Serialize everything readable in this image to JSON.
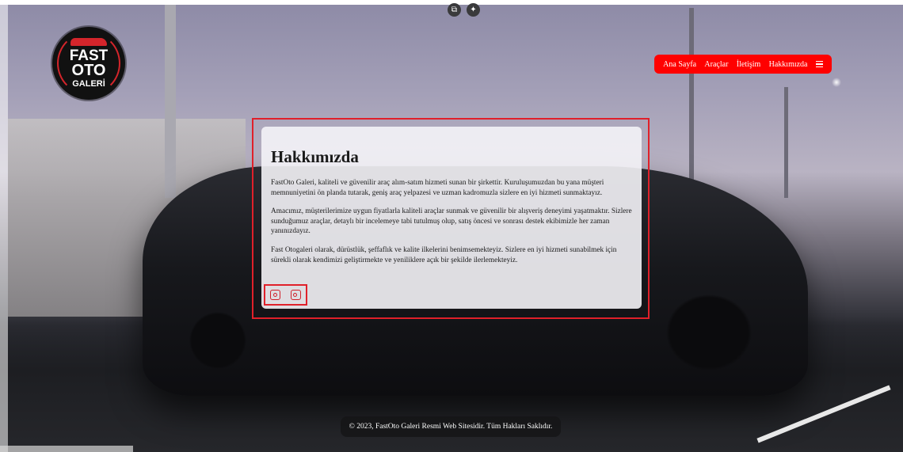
{
  "toolbar": {
    "icons": [
      "copy-icon",
      "sparkle-icon"
    ]
  },
  "logo": {
    "line1": "FAST",
    "line2": "OTO",
    "line3": "GALERİ"
  },
  "nav": {
    "items": [
      "Ana Sayfa",
      "Araçlar",
      "İletişim",
      "Hakkımızda"
    ],
    "menu_icon": "hamburger-icon"
  },
  "about": {
    "title": "Hakkımızda",
    "paragraphs": [
      "FastOto Galeri, kaliteli ve güvenilir araç alım-satım hizmeti sunan bir şirkettir. Kuruluşumuzdan bu yana müşteri memnuniyetini ön planda tutarak, geniş araç yelpazesi ve uzman kadromuzla sizlere en iyi hizmeti sunmaktayız.",
      "Amacımız, müşterilerimize uygun fiyatlarla kaliteli araçlar sunmak ve güvenilir bir alışveriş deneyimi yaşatmaktır. Sizlere sunduğumuz araçlar, detaylı bir incelemeye tabi tutulmuş olup, satış öncesi ve sonrası destek ekibimizle her zaman yanınızdayız.",
      "Fast Otogaleri olarak, dürüstlük, şeffaflık ve kalite ilkelerini benimsemekteyiz. Sizlere en iyi hizmeti sunabilmek için sürekli olarak kendimizi geliştirmekte ve yeniliklere açık bir şekilde ilerlemekteyiz."
    ],
    "social_icons": [
      "instagram-icon",
      "instagram-icon"
    ]
  },
  "footer": {
    "text": "© 2023, FastOto Galeri Resmi Web Sitesidir. Tüm Hakları Saklıdır."
  },
  "colors": {
    "accent": "#ff0000",
    "frame": "#e0202a",
    "card": "#f4f3f7"
  }
}
